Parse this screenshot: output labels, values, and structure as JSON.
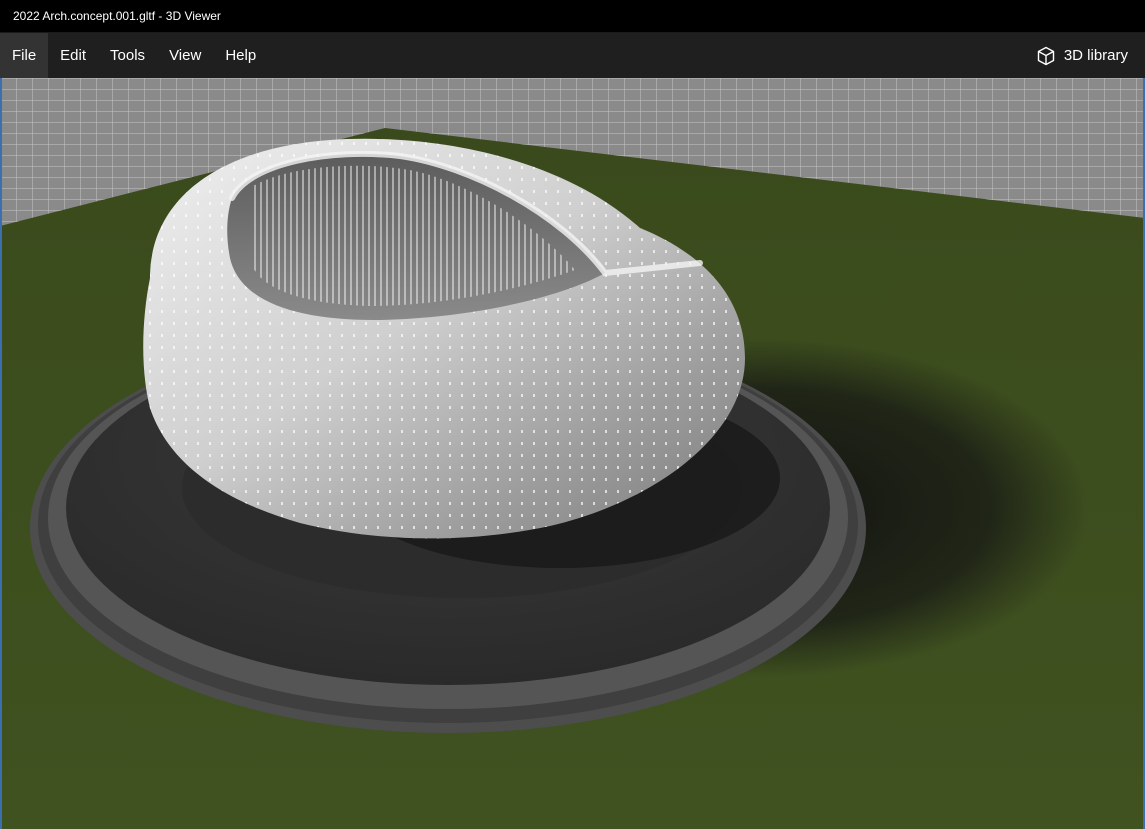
{
  "window": {
    "title": "2022 Arch.concept.001.gltf - 3D Viewer"
  },
  "menu": {
    "items": [
      {
        "label": "File",
        "active": true
      },
      {
        "label": "Edit",
        "active": false
      },
      {
        "label": "Tools",
        "active": false
      },
      {
        "label": "View",
        "active": false
      },
      {
        "label": "Help",
        "active": false
      }
    ],
    "library_label": "3D library",
    "library_icon": "cube-icon"
  },
  "scene": {
    "sky_grid_color": "#8f8f8f",
    "ground_color": "#3b4a1e",
    "plinth_color": "#4a4a4a",
    "shell_color": "#d8d8d8"
  }
}
